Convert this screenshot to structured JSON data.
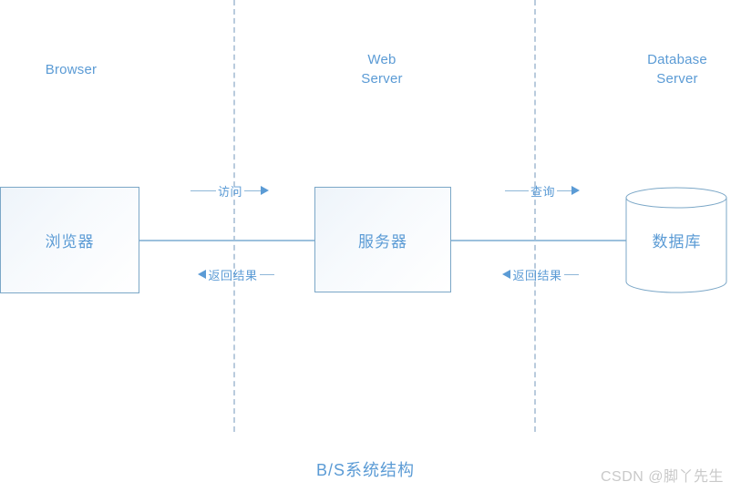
{
  "diagram": {
    "title": "B/S系统结构",
    "watermark": "CSDN @脚丫先生",
    "accent_color": "#5b9bd5",
    "divider_color": "#b9cbdd",
    "line_color": "#9cc0dd",
    "watermark_color": "#c9c9c9"
  },
  "columns": [
    {
      "id": "browser",
      "header": "Browser"
    },
    {
      "id": "web",
      "header": "Web\nServer"
    },
    {
      "id": "database",
      "header": "Database\nServer"
    }
  ],
  "nodes": [
    {
      "id": "browser",
      "label": "浏览器",
      "shape": "rectangle"
    },
    {
      "id": "server",
      "label": "服务器",
      "shape": "rectangle"
    },
    {
      "id": "database",
      "label": "数据库",
      "shape": "cylinder"
    }
  ],
  "flows": [
    {
      "id": "access",
      "label": "访问",
      "direction": "right",
      "from": "browser",
      "to": "server"
    },
    {
      "id": "return-1",
      "label": "返回结果",
      "direction": "left",
      "from": "server",
      "to": "browser"
    },
    {
      "id": "query",
      "label": "查询",
      "direction": "right",
      "from": "server",
      "to": "database"
    },
    {
      "id": "return-2",
      "label": "返回结果",
      "direction": "left",
      "from": "database",
      "to": "server"
    }
  ]
}
